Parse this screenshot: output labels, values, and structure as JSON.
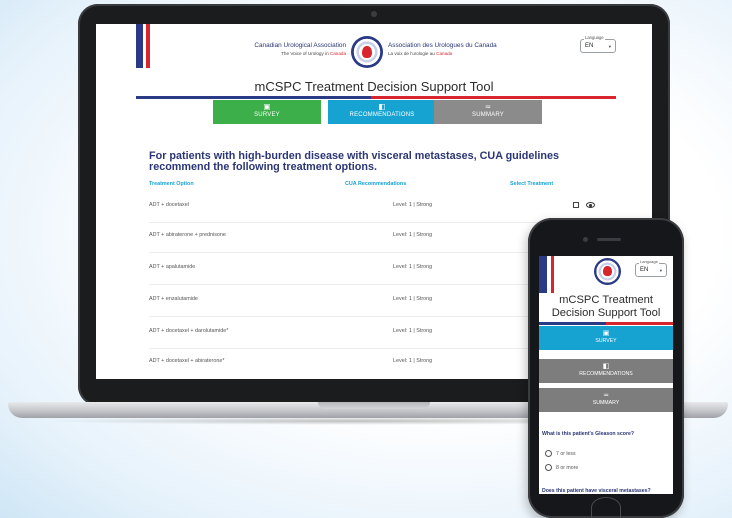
{
  "laptop": {
    "header": {
      "assoc_en_name": "Canadian Urological Association",
      "assoc_en_tagline_lead": "The Voice of Urology in",
      "assoc_en_tagline_country": "Canada",
      "assoc_fr_name": "Association des Urologues du Canada",
      "assoc_fr_tagline_lead": "La voix de l'urologie au",
      "assoc_fr_tagline_country": "Canada",
      "language": {
        "label": "Language",
        "value": "EN",
        "caret": "▾"
      }
    },
    "title": "mCSPC Treatment Decision Support Tool",
    "tabs": [
      {
        "label": "SURVEY",
        "icon": "survey-icon",
        "glyph": "▣"
      },
      {
        "label": "RECOMMENDATIONS",
        "icon": "recommendations-icon",
        "glyph": "◧"
      },
      {
        "label": "SUMMARY",
        "icon": "summary-icon",
        "glyph": "≂"
      }
    ],
    "headline": "For patients with high-burden disease with visceral metastases, CUA guidelines recommend the following treatment options.",
    "columns": {
      "option": "Treatment Option",
      "recommendation": "CUA Recommendations",
      "select": "Select Treatment"
    },
    "rows": [
      {
        "option": "ADT + docetaxel",
        "level": "Level: 1 | Strong"
      },
      {
        "option": "ADT + abiraterone + prednisone",
        "level": "Level: 1 | Strong"
      },
      {
        "option": "ADT + apalutamide",
        "level": "Level: 1 | Strong"
      },
      {
        "option": "ADT + enzalutamide",
        "level": "Level: 1 | Strong"
      },
      {
        "option": "ADT + docetaxel + darolutamide*",
        "level": "Level: 1 | Strong"
      },
      {
        "option": "ADT + docetaxel + abiraterone*",
        "level": "Level: 1 | Strong"
      }
    ]
  },
  "phone": {
    "language": {
      "label": "Language",
      "value": "EN",
      "caret": "▾"
    },
    "title": "mCSPC Treatment Decision Support Tool",
    "tabs": [
      {
        "label": "SURVEY",
        "glyph": "▣"
      },
      {
        "label": "RECOMMENDATIONS",
        "glyph": "◧"
      },
      {
        "label": "SUMMARY",
        "glyph": "≂"
      }
    ],
    "question_1": "What is this patient's Gleason score?",
    "options": [
      "7 or less",
      "8 or more"
    ],
    "question_2": "Does this patient have visceral metastases?"
  },
  "colors": {
    "navy": "#2b3674",
    "flag_blue": "#2a3a87",
    "flag_red": "#d9262e",
    "survey_green": "#3cae4a",
    "accent_cyan": "#17a3d1",
    "tab_gray": "#8b8b8b"
  }
}
